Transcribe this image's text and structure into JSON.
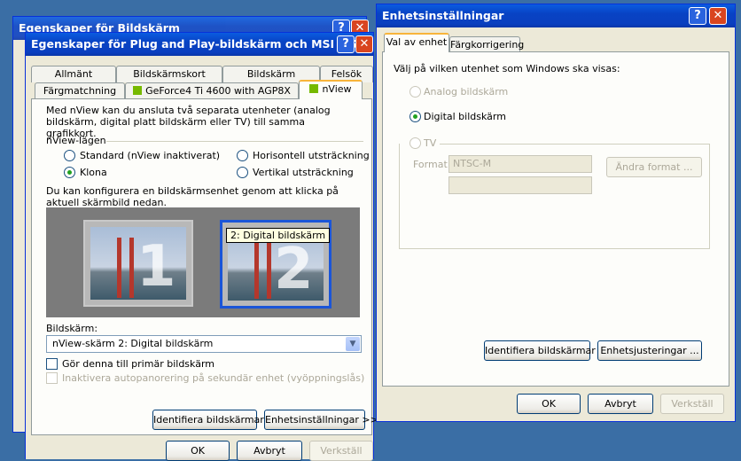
{
  "back_window": {
    "title": "Egenskaper för Bildskärm"
  },
  "main_window": {
    "title": "Egenskaper för Plug and Play-bildskärm och MSI MS-S...",
    "tabs_row1": [
      "Allmänt",
      "Bildskärmskort",
      "Bildskärm",
      "Felsök"
    ],
    "tabs_row2": [
      "Färgmatchning",
      "GeForce4 Ti 4600 with AGP8X",
      "nView"
    ],
    "intro": "Med nView kan du ansluta två separata utenheter (analog bildskärm, digital platt bildskärm eller TV) till samma grafikkort.",
    "modes_label": "nView-lägen",
    "modes": {
      "standard": "Standard (nView inaktiverat)",
      "clone": "Klona",
      "horizontal": "Horisontell utsträckning",
      "vertical": "Vertikal utsträckning"
    },
    "config_text": "Du kan konfigurera en bildskärmsenhet genom att klicka på aktuell skärmbild nedan.",
    "monitor1_num": "1",
    "monitor2_num": "2",
    "tooltip": "2: Digital bildskärm",
    "display_label": "Bildskärm:",
    "display_selected": "nView-skärm 2: Digital bildskärm",
    "primary_check": "Gör denna till primär bildskärm",
    "autopan_check": "Inaktivera autopanorering på sekundär enhet (vyöppningslås)",
    "identify_btn": "Identifiera bildskärmar",
    "device_settings_btn": "Enhetsinställningar >>",
    "ok": "OK",
    "cancel": "Avbryt",
    "apply": "Verkställ"
  },
  "device_window": {
    "title": "Enhetsinställningar",
    "tabs": [
      "Val av enhet",
      "Färgkorrigering"
    ],
    "prompt": "Välj på vilken utenhet som Windows ska visas:",
    "analog": "Analog bildskärm",
    "digital": "Digital bildskärm",
    "tv": "TV",
    "format_label": "Format:",
    "format_value": "NTSC-M",
    "change_format_btn": "Ändra format ...",
    "identify_btn": "Identifiera bildskärmar",
    "adjust_btn": "Enhetsjusteringar ...",
    "ok": "OK",
    "cancel": "Avbryt",
    "apply": "Verkställ"
  }
}
